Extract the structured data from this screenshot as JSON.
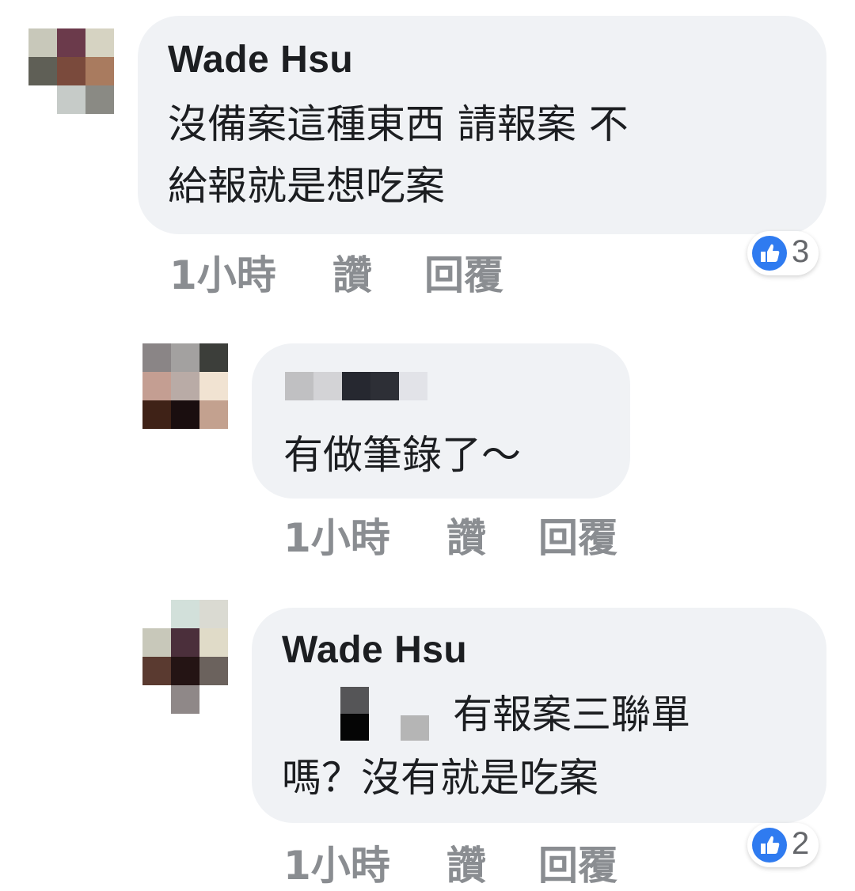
{
  "comments": [
    {
      "author": "Wade Hsu",
      "text_line1": "沒備案這種東西 請報案 不",
      "text_line2": "給報就是想吃案",
      "time": "1小時",
      "like_label": "讚",
      "reply_label": "回覆",
      "reaction_count": "3",
      "avatar_colors": [
        "#c8c8ba",
        "#6b3a4b",
        "#d6d3c2",
        "#5f5f56",
        "#7a4a3c",
        "#a97b5f",
        "#ffffff",
        "#c6cbc8",
        "#8a8a84"
      ]
    },
    {
      "author": "",
      "text": "有做筆錄了～",
      "time": "1小時",
      "like_label": "讚",
      "reply_label": "回覆",
      "avatar_colors": [
        "#8a8586",
        "#a3a1a0",
        "#3c3e3a",
        "#c49e92",
        "#b9aba6",
        "#f1e3d2",
        "#3f2217",
        "#1a0e0f",
        "#c3a18f"
      ]
    },
    {
      "author": "Wade Hsu",
      "text_line1": "有報案三聯單",
      "text_line2": "嗎？沒有就是吃案",
      "time": "1小時",
      "like_label": "讚",
      "reply_label": "回覆",
      "reaction_count": "2",
      "avatar_colors": [
        "#ffffff",
        "#d2e0da",
        "#dadad2",
        "#c8c8ba",
        "#4b2f3b",
        "#e0dbc8",
        "#5a3a30",
        "#241414",
        "#6b625d",
        "#ffffff",
        "#8f8888",
        "#ffffff"
      ]
    }
  ]
}
